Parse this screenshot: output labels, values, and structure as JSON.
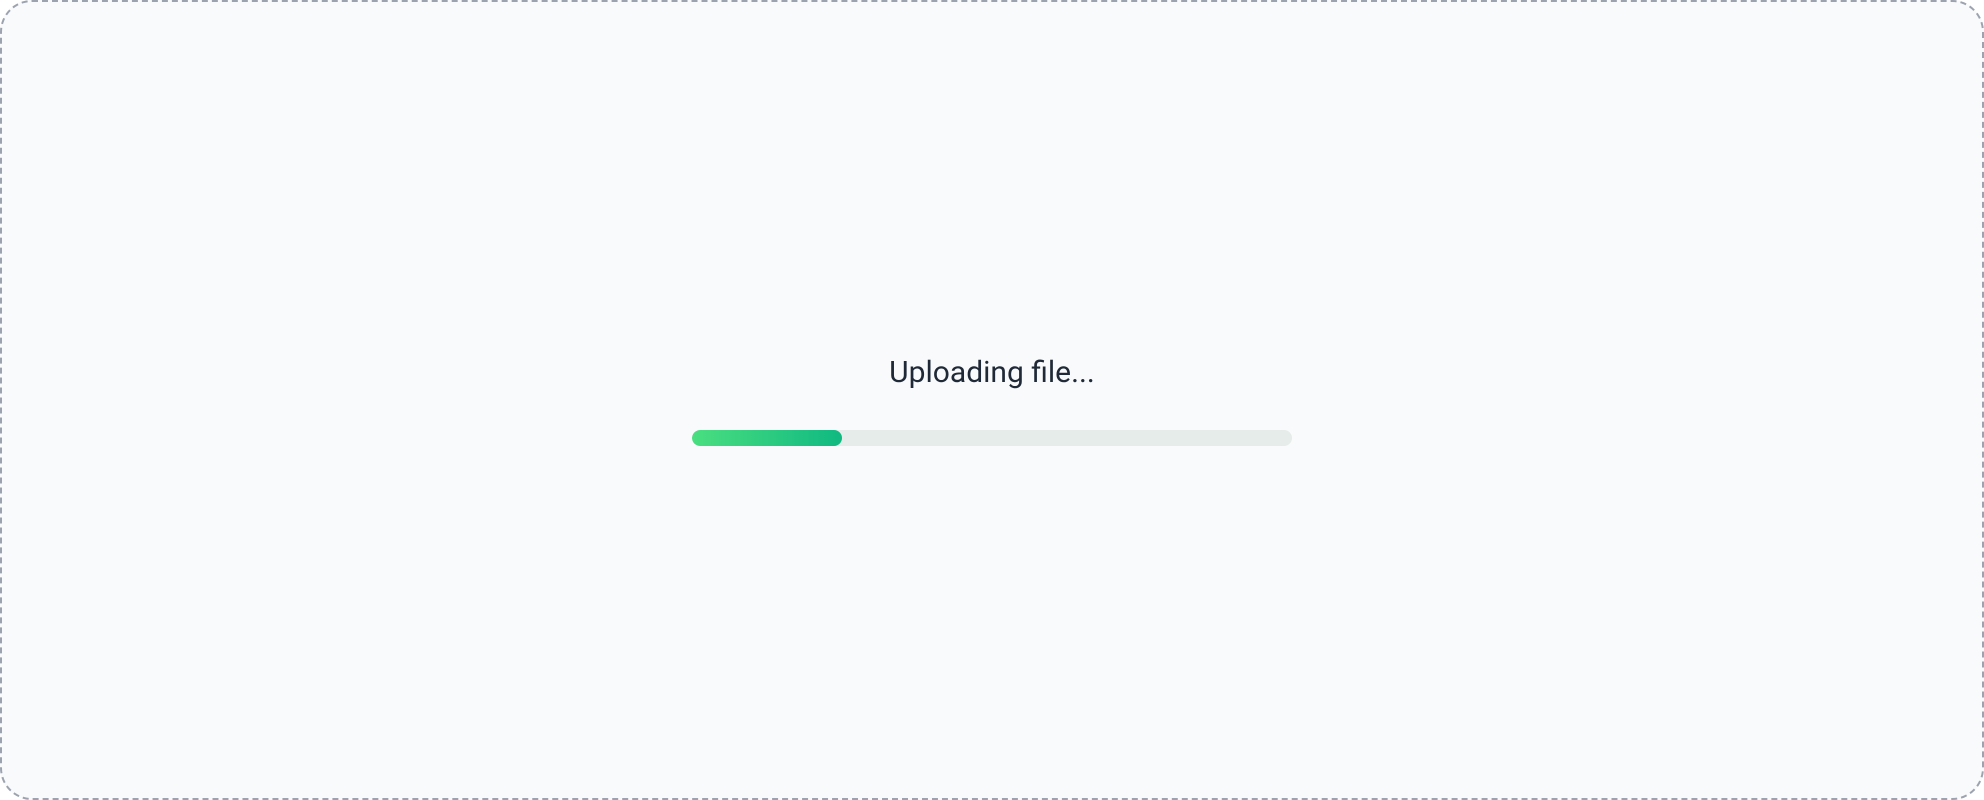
{
  "upload": {
    "title": "Uploading file...",
    "progress_percent": 25,
    "colors": {
      "container_bg": "#f9fafb",
      "border": "#9ca3af",
      "title_color": "#1f2937",
      "progress_track": "#e5ecea",
      "progress_fill_start": "#4ade80",
      "progress_fill_end": "#10b981"
    }
  }
}
